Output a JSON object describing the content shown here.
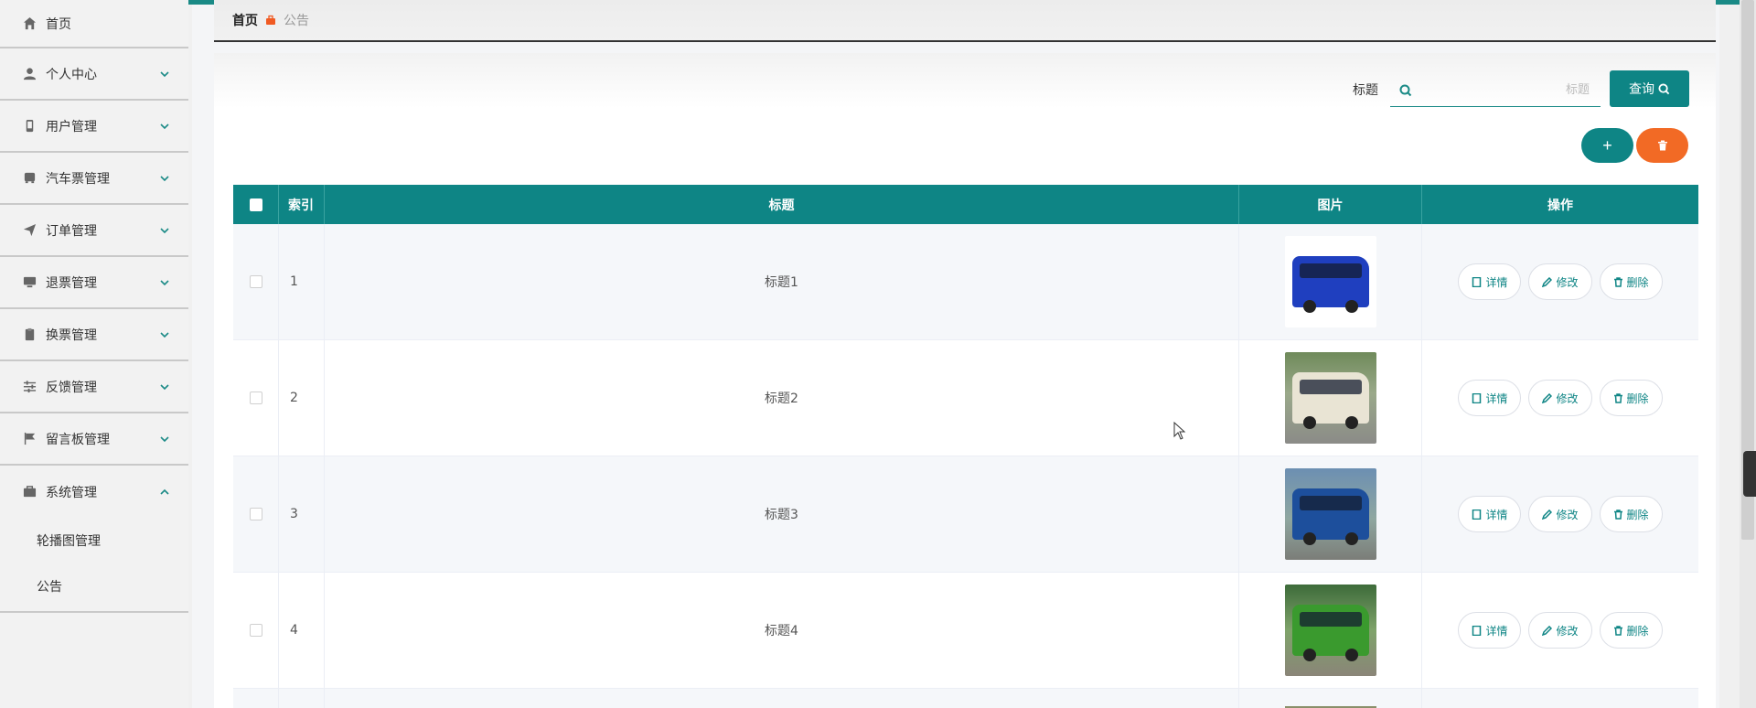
{
  "sidebar": {
    "items": [
      {
        "label": "首页",
        "icon": "home-icon"
      },
      {
        "label": "个人中心",
        "icon": "user-icon"
      },
      {
        "label": "用户管理",
        "icon": "phone-icon"
      },
      {
        "label": "汽车票管理",
        "icon": "bus-icon"
      },
      {
        "label": "订单管理",
        "icon": "send-icon"
      },
      {
        "label": "退票管理",
        "icon": "monitor-icon"
      },
      {
        "label": "换票管理",
        "icon": "clipboard-icon"
      },
      {
        "label": "反馈管理",
        "icon": "sliders-icon"
      },
      {
        "label": "留言板管理",
        "icon": "flag-icon"
      },
      {
        "label": "系统管理",
        "icon": "briefcase-icon"
      }
    ],
    "sub_items": [
      "轮播图管理",
      "公告"
    ]
  },
  "breadcrumb": {
    "home": "首页",
    "current": "公告"
  },
  "search": {
    "label": "标题",
    "placeholder": "标题",
    "button": "查询"
  },
  "table": {
    "headers": {
      "index": "索引",
      "title": "标题",
      "image": "图片",
      "actions": "操作"
    },
    "rows": [
      {
        "index": "1",
        "title": "标题1"
      },
      {
        "index": "2",
        "title": "标题2"
      },
      {
        "index": "3",
        "title": "标题3"
      },
      {
        "index": "4",
        "title": "标题4"
      }
    ],
    "actions": {
      "detail": "详情",
      "edit": "修改",
      "delete": "删除"
    }
  },
  "colors": {
    "accent": "#0e8585",
    "danger": "#f26a25"
  }
}
